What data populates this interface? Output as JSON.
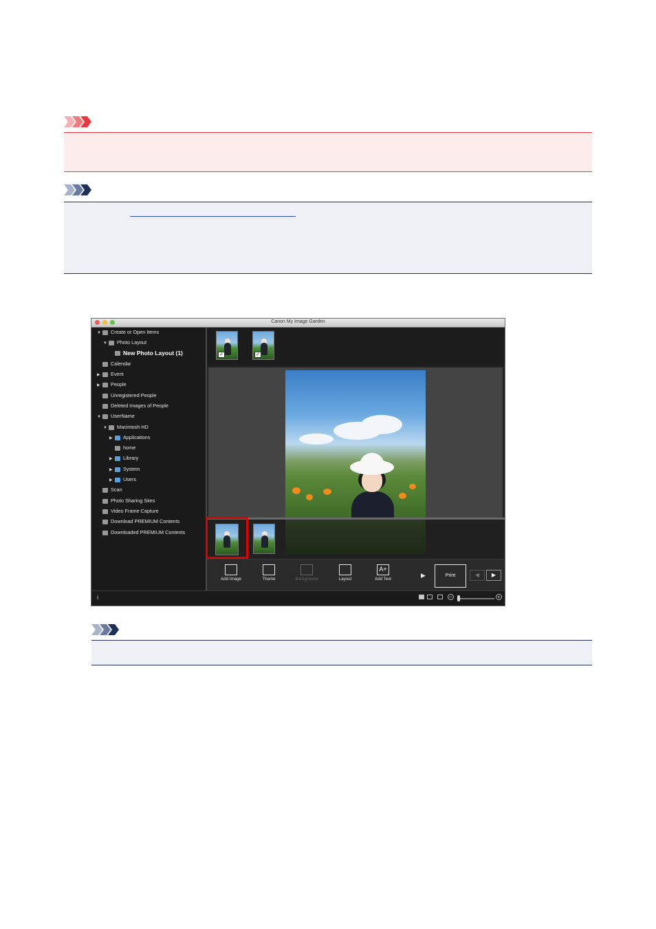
{
  "window": {
    "title": "Canon My Image Garden"
  },
  "sidebar": {
    "items": [
      {
        "label": "Create or Open Items",
        "expander": "▼",
        "icon": "create-items-icon"
      },
      {
        "label": "Photo Layout",
        "expander": "▼",
        "icon": "photo-layout-icon"
      },
      {
        "label": "New Photo Layout (1)",
        "expander": "",
        "icon": "layout-item-icon"
      },
      {
        "label": "Calendar",
        "expander": "",
        "icon": "calendar-icon"
      },
      {
        "label": "Event",
        "expander": "▶",
        "icon": "event-icon"
      },
      {
        "label": "People",
        "expander": "▶",
        "icon": "people-icon"
      },
      {
        "label": "Unregistered People",
        "expander": "",
        "icon": "unregistered-people-icon"
      },
      {
        "label": "Deleted Images of People",
        "expander": "",
        "icon": "deleted-people-icon"
      },
      {
        "label": "UserName",
        "expander": "▼",
        "icon": "computer-icon"
      },
      {
        "label": "Macintosh HD",
        "expander": "▼",
        "icon": "hard-drive-icon"
      },
      {
        "label": "Applications",
        "expander": "▶",
        "icon": "folder-icon"
      },
      {
        "label": "home",
        "expander": "",
        "icon": "home-icon"
      },
      {
        "label": "Library",
        "expander": "▶",
        "icon": "folder-icon"
      },
      {
        "label": "System",
        "expander": "▶",
        "icon": "folder-icon"
      },
      {
        "label": "Users",
        "expander": "▶",
        "icon": "folder-icon"
      },
      {
        "label": "Scan",
        "expander": "",
        "icon": "scan-icon"
      },
      {
        "label": "Photo Sharing Sites",
        "expander": "",
        "icon": "photo-sharing-icon"
      },
      {
        "label": "Video Frame Capture",
        "expander": "",
        "icon": "video-frame-icon"
      },
      {
        "label": "Download PREMIUM Contents",
        "expander": "",
        "icon": "download-icon"
      },
      {
        "label": "Downloaded PREMIUM Contents",
        "expander": "",
        "icon": "downloaded-icon"
      }
    ]
  },
  "toolbar": {
    "add_image": "Add Image",
    "theme": "Theme",
    "background": "Background",
    "layout": "Layout",
    "add_text": "Add Text",
    "print": "Print",
    "add_text_glyph": "A+",
    "more_glyph": "▶",
    "prev_glyph": "◀",
    "next_glyph": "▶"
  },
  "statusbar": {
    "info_glyph": "i",
    "zoom_out_glyph": "−",
    "zoom_in_glyph": "+"
  },
  "colors": {
    "important_accent": "#e8383d",
    "note_accent": "#1e2f5a",
    "selection_frame": "#e00000"
  }
}
